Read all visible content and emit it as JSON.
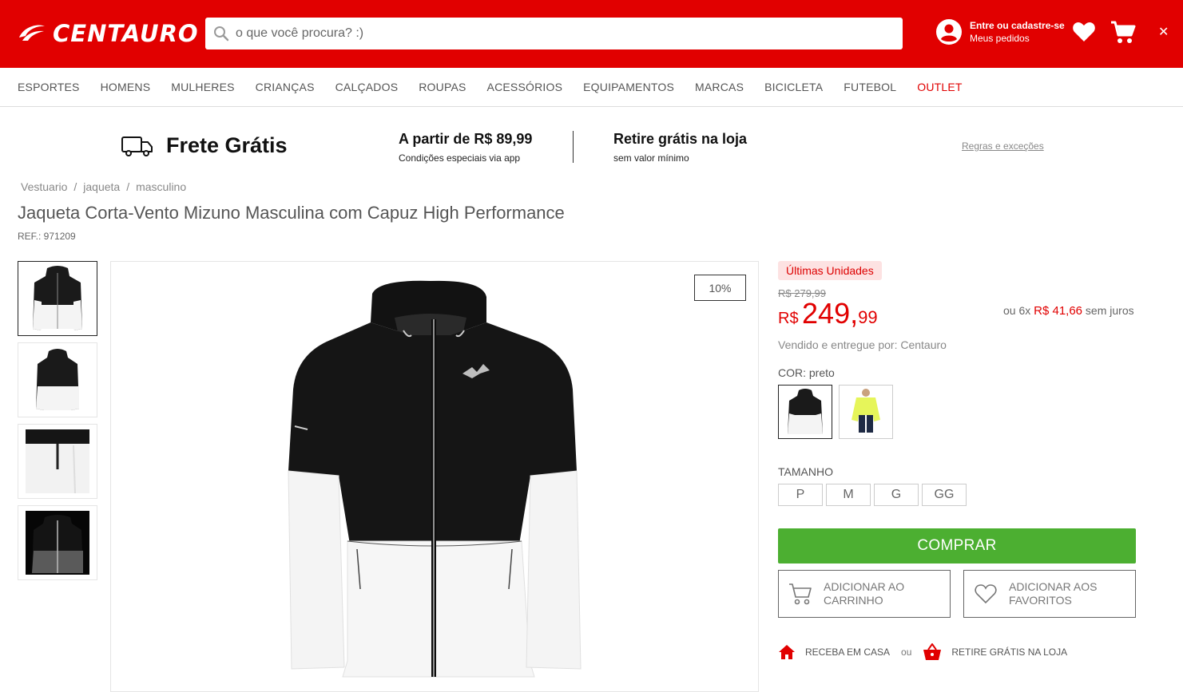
{
  "header": {
    "logo_text": "CENTAURO",
    "search_placeholder": "o que você procura? :)",
    "account_line1": "Entre ou cadastre-se",
    "account_line2": "Meus pedidos",
    "close_glyph": "✕",
    "brand_color": "#e10000"
  },
  "nav": {
    "items": [
      "ESPORTES",
      "HOMENS",
      "MULHERES",
      "CRIANÇAS",
      "CALÇADOS",
      "ROUPAS",
      "ACESSÓRIOS",
      "EQUIPAMENTOS",
      "MARCAS",
      "BICICLETA",
      "FUTEBOL",
      "OUTLET"
    ]
  },
  "shipping": {
    "title": "Frete Grátis",
    "col1_heading": "A partir de R$ 89,99",
    "col1_sub": "Condições especiais via app",
    "col2_heading": "Retire grátis na loja",
    "col2_sub": "sem valor mínimo",
    "rules_link": "Regras e exceções"
  },
  "breadcrumb": [
    "Vestuario",
    "jaqueta",
    "masculino"
  ],
  "breadcrumb_sep": "/",
  "product": {
    "title": "Jaqueta Corta-Vento Mizuno Masculina com Capuz High Performance",
    "ref": "REF.: 971209",
    "discount": "10%",
    "badge": "Últimas Unidades",
    "old_price": "R$ 279,99",
    "price_currency": "R$",
    "price_int": "249,",
    "price_dec": "99",
    "installments_prefix": "ou 6x",
    "installments_value": "R$ 41,66",
    "installments_suffix": "sem juros",
    "seller": "Vendido e entregue por: Centauro",
    "color_label": "COR: preto",
    "size_label": "TAMANHO",
    "sizes": [
      "P",
      "M",
      "G",
      "GG"
    ],
    "buy_label": "COMPRAR",
    "add_cart_label": "ADICIONAR AO CARRINHO",
    "add_fav_label": "ADICIONAR AOS FAVORITOS",
    "delivery_home": "RECEBA EM CASA",
    "delivery_or": "ou",
    "delivery_store": "RETIRE GRÁTIS NA LOJA",
    "buy_color": "#4caf31"
  }
}
